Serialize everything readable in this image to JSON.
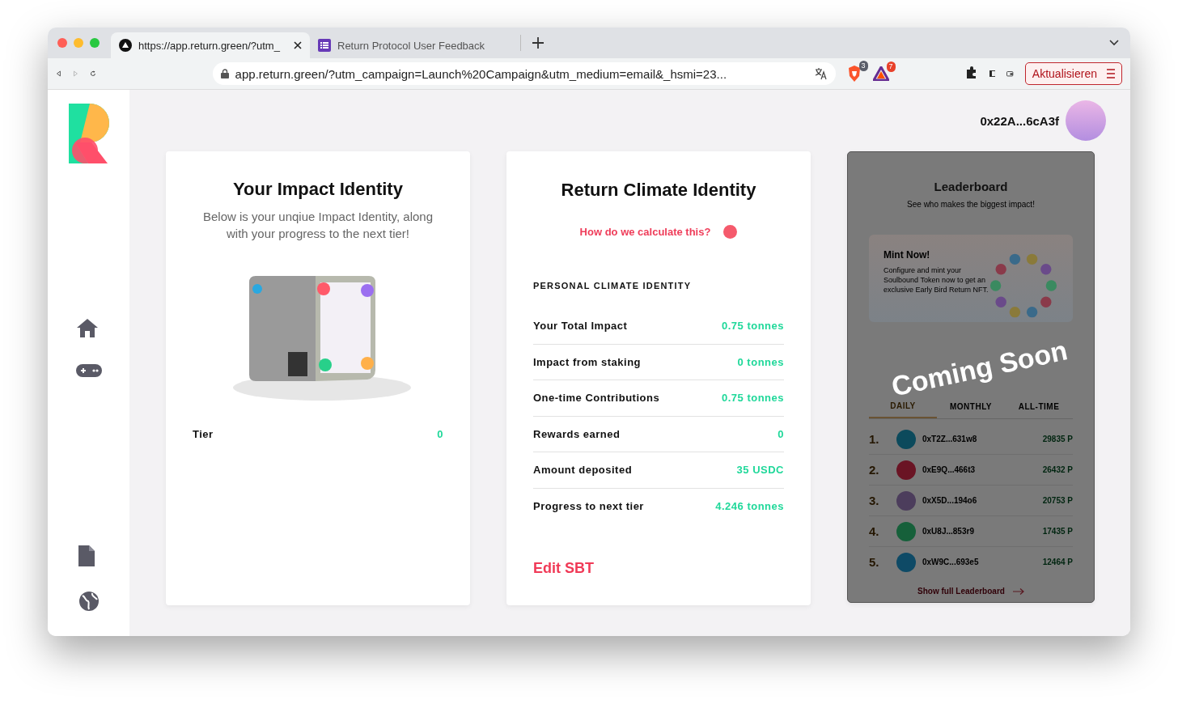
{
  "browser": {
    "tabs": [
      {
        "title": "https://app.return.green/?utm_",
        "selected": true
      },
      {
        "title": "Return Protocol User Feedback",
        "selected": false
      }
    ],
    "address": "app.return.green/?utm_campaign=Launch%20Campaign&utm_medium=email&_hsmi=23...",
    "badges": [
      "3",
      "7"
    ],
    "update_button": "Aktualisieren"
  },
  "header": {
    "wallet": "0x22A...6cA3f"
  },
  "sidebar": {
    "items": [
      {
        "kind": "home"
      },
      {
        "kind": "games"
      },
      {
        "kind": "document"
      },
      {
        "kind": "globe"
      }
    ]
  },
  "impact_card": {
    "title": "Your Impact Identity",
    "subtitle": "Below is your unqiue Impact Identity, along with your progress to the next tier!",
    "tier_label": "Tier",
    "tier_value": "0"
  },
  "climate_card": {
    "title": "Return Climate Identity",
    "help_link": "How do we calculate this?",
    "section_heading": "PERSONAL CLIMATE IDENTITY",
    "rows": [
      {
        "label": "Your Total Impact",
        "value": "0.75 tonnes"
      },
      {
        "label": "Impact from staking",
        "value": "0 tonnes"
      },
      {
        "label": "One-time Contributions",
        "value": "0.75 tonnes"
      },
      {
        "label": "Rewards earned",
        "value": "0"
      },
      {
        "label": "Amount deposited",
        "value": "35 USDC"
      },
      {
        "label": "Progress to next tier",
        "value": "4.246 tonnes"
      }
    ],
    "edit_button": "Edit SBT"
  },
  "leaderboard": {
    "title": "Leaderboard",
    "subtitle": "See who makes the biggest impact!",
    "promo": {
      "title": "Mint Now!",
      "text": "Configure and mint your Soulbound Token now to get an exclusive Early Bird Return NFT."
    },
    "tabs": [
      {
        "label": "DAILY",
        "selected": true
      },
      {
        "label": "MONTHLY",
        "selected": false
      },
      {
        "label": "ALL-TIME",
        "selected": false
      }
    ],
    "entries": [
      {
        "rank": "1.",
        "address": "0xT2Z...631w8",
        "points": "29835 P",
        "color": "#0c4a5c"
      },
      {
        "rank": "2.",
        "address": "0xE9Q...466t3",
        "points": "26432 P",
        "color": "#6a1424"
      },
      {
        "rank": "3.",
        "address": "0xX5D...194o6",
        "points": "20753 P",
        "color": "#4c3d5c"
      },
      {
        "rank": "4.",
        "address": "0xU8J...853r9",
        "points": "17435 P",
        "color": "#16603a"
      },
      {
        "rank": "5.",
        "address": "0xW9C...693e5",
        "points": "12464 P",
        "color": "#0e4a66"
      }
    ],
    "footer_link": "Show full Leaderboard",
    "overlay": "Coming Soon"
  }
}
